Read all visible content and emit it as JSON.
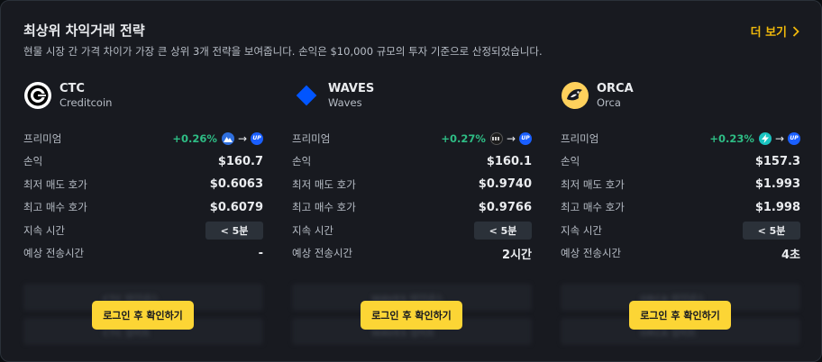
{
  "header": {
    "title": "최상위 차익거래 전략",
    "subtitle": "현물 시장 간 가격 차이가 가장 큰 상위 3개 전략을 보여줍니다. 손익은 $10,000 규모의 투자 기준으로 산정되었습니다.",
    "more_label": "더 보기"
  },
  "labels": {
    "premium": "프리미엄",
    "pnl": "손익",
    "lowest_ask": "최저 매도 호가",
    "highest_bid": "최고 매수 호가",
    "duration": "지속 시간",
    "transfer_time": "예상 전송시간",
    "login_button": "로그인 후 확인하기"
  },
  "cards": [
    {
      "symbol": "CTC",
      "name": "Creditcoin",
      "logo": "ctc-logo",
      "premium": "+0.26%",
      "buy_exchange": "mountain-exchange-icon",
      "sell_exchange": "UP",
      "pnl": "$160.7",
      "lowest_ask": "$0.6063",
      "highest_bid": "$0.6079",
      "duration": "< 5분",
      "transfer_time": "-",
      "blur_1": "CTC 바이낸스",
      "blur_2": "CTC 업비트"
    },
    {
      "symbol": "WAVES",
      "name": "Waves",
      "logo": "waves-logo",
      "premium": "+0.27%",
      "buy_exchange": "generic-exchange-icon",
      "sell_exchange": "UP",
      "pnl": "$160.1",
      "lowest_ask": "$0.9740",
      "highest_bid": "$0.9766",
      "duration": "< 5분",
      "transfer_time": "2시간",
      "blur_1": "WAVES 바이낸스",
      "blur_2": "WAVES 업비트"
    },
    {
      "symbol": "ORCA",
      "name": "Orca",
      "logo": "orca-logo",
      "premium": "+0.23%",
      "buy_exchange": "lightning-exchange-icon",
      "sell_exchange": "UP",
      "pnl": "$157.3",
      "lowest_ask": "$1.993",
      "highest_bid": "$1.998",
      "duration": "< 5분",
      "transfer_time": "4초",
      "blur_1": "ORCA 바이낸스",
      "blur_2": "ORCA 업비트"
    }
  ],
  "colors": {
    "accent": "#f0b90b",
    "button": "#fcd535",
    "positive": "#2ebd85",
    "upbit": "#1a5fff"
  }
}
